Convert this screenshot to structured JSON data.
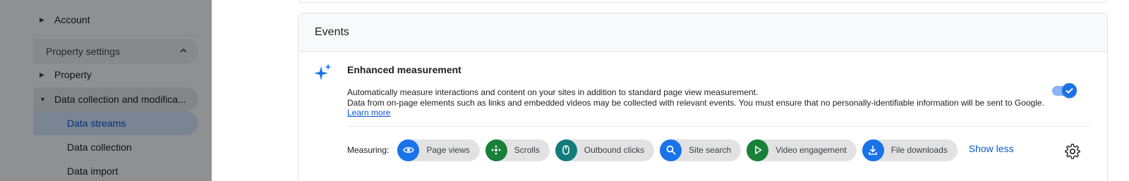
{
  "sidebar": {
    "account_label": "Account",
    "property_settings_label": "Property settings",
    "property_label": "Property",
    "data_collection_group_label": "Data collection and modifica...",
    "items": [
      {
        "label": "Data streams"
      },
      {
        "label": "Data collection"
      },
      {
        "label": "Data import"
      }
    ]
  },
  "events": {
    "header_title": "Events",
    "enhanced_measurement": {
      "title": "Enhanced measurement",
      "description_line1": "Automatically measure interactions and content on your sites in addition to standard page view measurement.",
      "description_line2": "Data from on-page elements such as links and embedded videos may be collected with relevant events. You must ensure that no personally-identifiable information will be sent to Google.",
      "learn_more": "Learn more",
      "enabled": true
    },
    "measuring": {
      "label": "Measuring:",
      "chips": [
        {
          "label": "Page views",
          "icon": "eye-icon",
          "color": "#1a73e8"
        },
        {
          "label": "Scrolls",
          "icon": "scroll-crosshair-icon",
          "color": "#188038"
        },
        {
          "label": "Outbound clicks",
          "icon": "mouse-icon",
          "color": "#137b7b"
        },
        {
          "label": "Site search",
          "icon": "search-icon",
          "color": "#1a73e8"
        },
        {
          "label": "Video engagement",
          "icon": "play-icon",
          "color": "#188038"
        },
        {
          "label": "File downloads",
          "icon": "download-icon",
          "color": "#1a73e8"
        }
      ],
      "show_less": "Show less"
    }
  },
  "colors": {
    "accent_blue": "#0b57d0",
    "toggle_blue": "#1a73e8"
  }
}
